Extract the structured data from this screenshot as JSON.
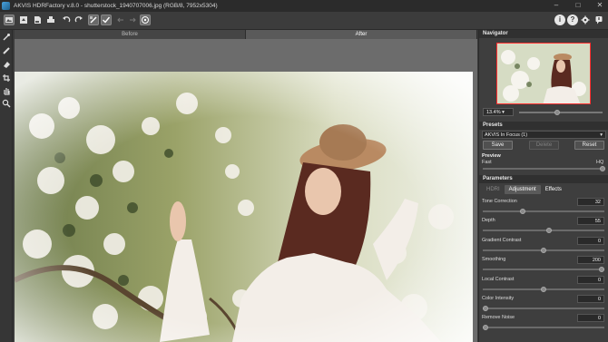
{
  "window": {
    "title": "AKVIS HDRFactory v.8.0 - shutterstock_1940707006.jpg (RGB/8, 7952x5304)"
  },
  "view_tabs": {
    "before": "Before",
    "after": "After"
  },
  "navigator": {
    "title": "Navigator",
    "zoom": "13.4% ▾",
    "zoom_position": 0.45
  },
  "presets": {
    "title": "Presets",
    "selected": "AKVIS In Focus (1)",
    "save": "Save",
    "delete": "Delete",
    "reset": "Reset"
  },
  "preview": {
    "title": "Preview",
    "fast": "Fast",
    "hq": "HQ"
  },
  "parameters": {
    "title": "Parameters",
    "tabs": [
      "HDRI",
      "Adjustment",
      "Effects"
    ],
    "items": [
      {
        "label": "Tone Correction",
        "value": "32",
        "position": 0.32
      },
      {
        "label": "Depth",
        "value": "55",
        "position": 0.55
      },
      {
        "label": "Gradient Contrast",
        "value": "0",
        "position": 0.5
      },
      {
        "label": "Smoothing",
        "value": "200",
        "position": 1.0
      },
      {
        "label": "Local Contrast",
        "value": "0",
        "position": 0.5
      },
      {
        "label": "Color Intensity",
        "value": "0",
        "position": 0.0
      },
      {
        "label": "Remove Noise",
        "value": "0",
        "position": 0.0
      }
    ]
  },
  "colors": {
    "accent": "#ff3030",
    "panel": "#3e3e3e",
    "header": "#303030"
  }
}
